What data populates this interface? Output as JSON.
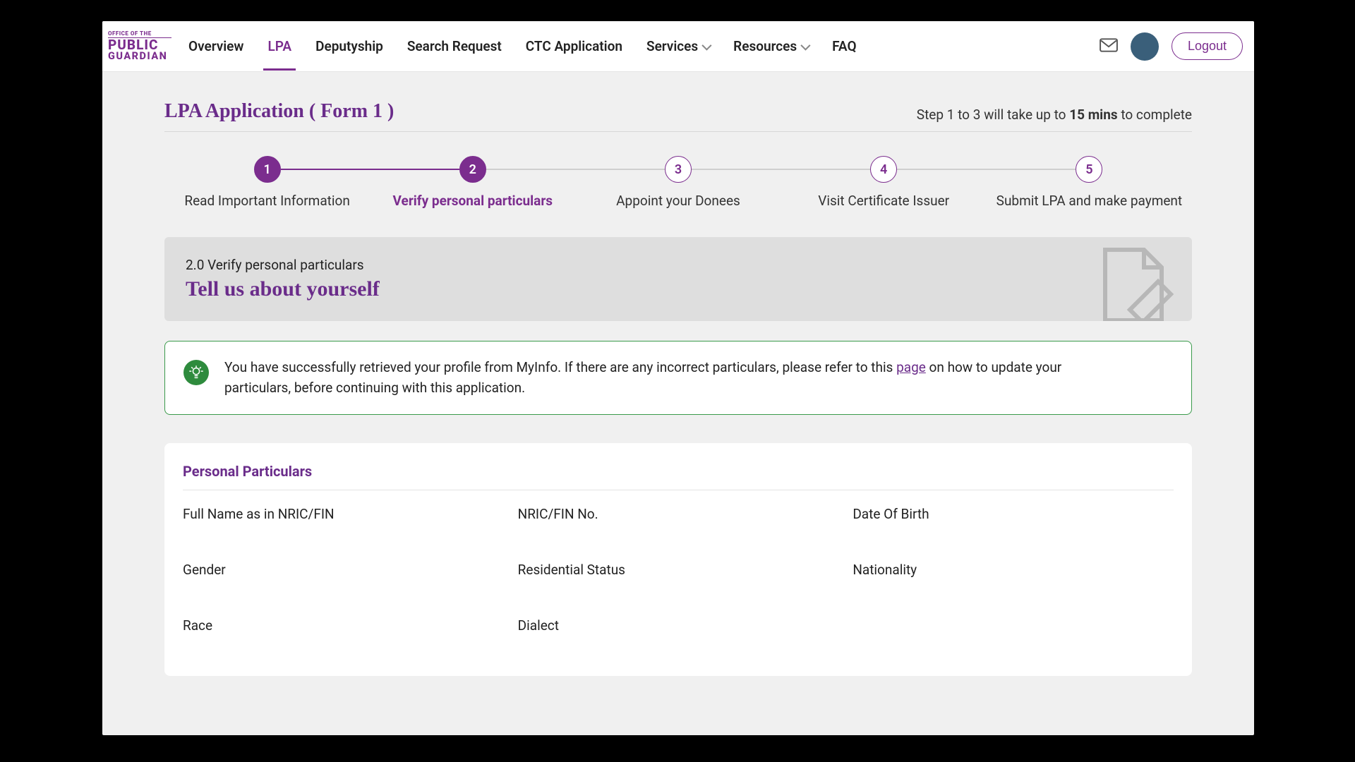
{
  "logo": {
    "small": "OFFICE OF THE",
    "main": "PUBLIC",
    "sub": "GUARDIAN"
  },
  "nav": {
    "overview": "Overview",
    "lpa": "LPA",
    "deputyship": "Deputyship",
    "search_request": "Search Request",
    "ctc_application": "CTC Application",
    "services": "Services",
    "resources": "Resources",
    "faq": "FAQ"
  },
  "header": {
    "logout": "Logout"
  },
  "page": {
    "title": "LPA Application ( Form 1 )",
    "time_prefix": "Step 1 to 3 will take up to ",
    "time_bold": "15 mins",
    "time_suffix": " to complete"
  },
  "steps": [
    {
      "num": "1",
      "label": "Read Important Information"
    },
    {
      "num": "2",
      "label": "Verify personal particulars"
    },
    {
      "num": "3",
      "label": "Appoint your Donees"
    },
    {
      "num": "4",
      "label": "Visit Certificate Issuer"
    },
    {
      "num": "5",
      "label": "Submit LPA and make payment"
    }
  ],
  "section": {
    "eyebrow": "2.0 Verify personal particulars",
    "heading": "Tell us about yourself"
  },
  "alert": {
    "pre": "You have successfully retrieved your profile from MyInfo. If there are any incorrect particulars, please refer to this ",
    "link": "page",
    "post": " on how to update your particulars, before continuing with this application."
  },
  "card": {
    "title": "Personal Particulars",
    "fields": {
      "full_name": "Full Name as in NRIC/FIN",
      "nric": "NRIC/FIN No.",
      "dob": "Date Of Birth",
      "gender": "Gender",
      "residential_status": "Residential Status",
      "nationality": "Nationality",
      "race": "Race",
      "dialect": "Dialect"
    }
  }
}
